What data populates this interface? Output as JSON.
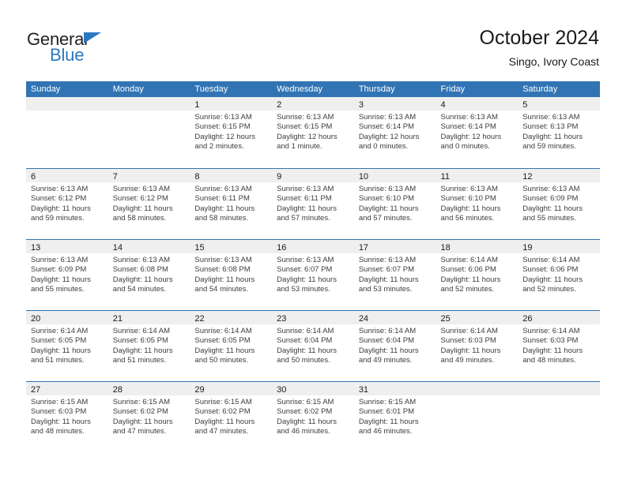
{
  "brand": {
    "name_part1": "General",
    "name_part2": "Blue",
    "triangle_icon": "blue-triangle-icon",
    "color_dark": "#231f20",
    "color_blue": "#2b78c0"
  },
  "header": {
    "title": "October 2024",
    "subtitle": "Singo, Ivory Coast"
  },
  "colors": {
    "header_blue": "#3174b4",
    "daynum_band": "#efefef",
    "text_dark": "#1a1a1a",
    "text_body": "#3d3d3d"
  },
  "weekdays": [
    "Sunday",
    "Monday",
    "Tuesday",
    "Wednesday",
    "Thursday",
    "Friday",
    "Saturday"
  ],
  "weeks": [
    {
      "days": [
        {
          "blank": true
        },
        {
          "blank": true
        },
        {
          "num": "1",
          "lines": [
            "Sunrise: 6:13 AM",
            "Sunset: 6:15 PM",
            "Daylight: 12 hours",
            "and 2 minutes."
          ]
        },
        {
          "num": "2",
          "lines": [
            "Sunrise: 6:13 AM",
            "Sunset: 6:15 PM",
            "Daylight: 12 hours",
            "and 1 minute."
          ]
        },
        {
          "num": "3",
          "lines": [
            "Sunrise: 6:13 AM",
            "Sunset: 6:14 PM",
            "Daylight: 12 hours",
            "and 0 minutes."
          ]
        },
        {
          "num": "4",
          "lines": [
            "Sunrise: 6:13 AM",
            "Sunset: 6:14 PM",
            "Daylight: 12 hours",
            "and 0 minutes."
          ]
        },
        {
          "num": "5",
          "lines": [
            "Sunrise: 6:13 AM",
            "Sunset: 6:13 PM",
            "Daylight: 11 hours",
            "and 59 minutes."
          ]
        }
      ]
    },
    {
      "days": [
        {
          "num": "6",
          "lines": [
            "Sunrise: 6:13 AM",
            "Sunset: 6:12 PM",
            "Daylight: 11 hours",
            "and 59 minutes."
          ]
        },
        {
          "num": "7",
          "lines": [
            "Sunrise: 6:13 AM",
            "Sunset: 6:12 PM",
            "Daylight: 11 hours",
            "and 58 minutes."
          ]
        },
        {
          "num": "8",
          "lines": [
            "Sunrise: 6:13 AM",
            "Sunset: 6:11 PM",
            "Daylight: 11 hours",
            "and 58 minutes."
          ]
        },
        {
          "num": "9",
          "lines": [
            "Sunrise: 6:13 AM",
            "Sunset: 6:11 PM",
            "Daylight: 11 hours",
            "and 57 minutes."
          ]
        },
        {
          "num": "10",
          "lines": [
            "Sunrise: 6:13 AM",
            "Sunset: 6:10 PM",
            "Daylight: 11 hours",
            "and 57 minutes."
          ]
        },
        {
          "num": "11",
          "lines": [
            "Sunrise: 6:13 AM",
            "Sunset: 6:10 PM",
            "Daylight: 11 hours",
            "and 56 minutes."
          ]
        },
        {
          "num": "12",
          "lines": [
            "Sunrise: 6:13 AM",
            "Sunset: 6:09 PM",
            "Daylight: 11 hours",
            "and 55 minutes."
          ]
        }
      ]
    },
    {
      "days": [
        {
          "num": "13",
          "lines": [
            "Sunrise: 6:13 AM",
            "Sunset: 6:09 PM",
            "Daylight: 11 hours",
            "and 55 minutes."
          ]
        },
        {
          "num": "14",
          "lines": [
            "Sunrise: 6:13 AM",
            "Sunset: 6:08 PM",
            "Daylight: 11 hours",
            "and 54 minutes."
          ]
        },
        {
          "num": "15",
          "lines": [
            "Sunrise: 6:13 AM",
            "Sunset: 6:08 PM",
            "Daylight: 11 hours",
            "and 54 minutes."
          ]
        },
        {
          "num": "16",
          "lines": [
            "Sunrise: 6:13 AM",
            "Sunset: 6:07 PM",
            "Daylight: 11 hours",
            "and 53 minutes."
          ]
        },
        {
          "num": "17",
          "lines": [
            "Sunrise: 6:13 AM",
            "Sunset: 6:07 PM",
            "Daylight: 11 hours",
            "and 53 minutes."
          ]
        },
        {
          "num": "18",
          "lines": [
            "Sunrise: 6:14 AM",
            "Sunset: 6:06 PM",
            "Daylight: 11 hours",
            "and 52 minutes."
          ]
        },
        {
          "num": "19",
          "lines": [
            "Sunrise: 6:14 AM",
            "Sunset: 6:06 PM",
            "Daylight: 11 hours",
            "and 52 minutes."
          ]
        }
      ]
    },
    {
      "days": [
        {
          "num": "20",
          "lines": [
            "Sunrise: 6:14 AM",
            "Sunset: 6:05 PM",
            "Daylight: 11 hours",
            "and 51 minutes."
          ]
        },
        {
          "num": "21",
          "lines": [
            "Sunrise: 6:14 AM",
            "Sunset: 6:05 PM",
            "Daylight: 11 hours",
            "and 51 minutes."
          ]
        },
        {
          "num": "22",
          "lines": [
            "Sunrise: 6:14 AM",
            "Sunset: 6:05 PM",
            "Daylight: 11 hours",
            "and 50 minutes."
          ]
        },
        {
          "num": "23",
          "lines": [
            "Sunrise: 6:14 AM",
            "Sunset: 6:04 PM",
            "Daylight: 11 hours",
            "and 50 minutes."
          ]
        },
        {
          "num": "24",
          "lines": [
            "Sunrise: 6:14 AM",
            "Sunset: 6:04 PM",
            "Daylight: 11 hours",
            "and 49 minutes."
          ]
        },
        {
          "num": "25",
          "lines": [
            "Sunrise: 6:14 AM",
            "Sunset: 6:03 PM",
            "Daylight: 11 hours",
            "and 49 minutes."
          ]
        },
        {
          "num": "26",
          "lines": [
            "Sunrise: 6:14 AM",
            "Sunset: 6:03 PM",
            "Daylight: 11 hours",
            "and 48 minutes."
          ]
        }
      ]
    },
    {
      "days": [
        {
          "num": "27",
          "lines": [
            "Sunrise: 6:15 AM",
            "Sunset: 6:03 PM",
            "Daylight: 11 hours",
            "and 48 minutes."
          ]
        },
        {
          "num": "28",
          "lines": [
            "Sunrise: 6:15 AM",
            "Sunset: 6:02 PM",
            "Daylight: 11 hours",
            "and 47 minutes."
          ]
        },
        {
          "num": "29",
          "lines": [
            "Sunrise: 6:15 AM",
            "Sunset: 6:02 PM",
            "Daylight: 11 hours",
            "and 47 minutes."
          ]
        },
        {
          "num": "30",
          "lines": [
            "Sunrise: 6:15 AM",
            "Sunset: 6:02 PM",
            "Daylight: 11 hours",
            "and 46 minutes."
          ]
        },
        {
          "num": "31",
          "lines": [
            "Sunrise: 6:15 AM",
            "Sunset: 6:01 PM",
            "Daylight: 11 hours",
            "and 46 minutes."
          ]
        },
        {
          "blank": true
        },
        {
          "blank": true
        }
      ]
    }
  ]
}
